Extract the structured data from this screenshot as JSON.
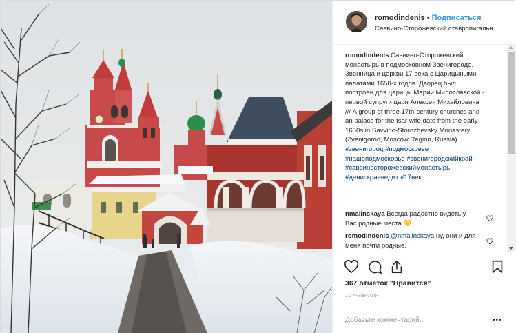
{
  "post": {
    "username": "romodindenis",
    "follow_label": "Подписаться",
    "dot": "•",
    "location": "Саввино-Сторожевский ставропигальн...",
    "caption": {
      "username": "romodindenis",
      "text": "Саввино-Сторожевский монастырь в подмосковном Звенигороде. Звонница и церкви 17 века с Царицыными палатами 1650-х годов. Дворец был построен для царицы Марии Милославской - первой супруги царя Алексея Михайловича /// A group of three 17th-century churches and an palace for the tsar wife date from the early 1650s in Savvino-Storozhevsky Monastery (Zvenigorod, Moscow Region, Russia)",
      "hashtags": [
        "#звенигород",
        "#подмосковье",
        "#нашеподмосковье",
        "#звенигородскийкрай",
        "#саввиносторожевскиймонастырь",
        "#денискраеведит",
        "#17век"
      ]
    },
    "comments": [
      {
        "username": "nmalinskaya",
        "text": "Всегда радостно видеть у Вас родные места.",
        "emoji": "💛"
      },
      {
        "username": "romodindenis",
        "mention": "@nmalinskaya",
        "text": "ну, они и для меня почти родные."
      }
    ],
    "likes": "367 отметок \"Нравится\"",
    "date": "10 ФЕВРАЛЯ",
    "add_comment_placeholder": "Добавьте комментарий...",
    "more_label": "•••"
  },
  "icons": {
    "like": "heart-icon",
    "comment": "comment-icon",
    "share": "share-icon",
    "save": "bookmark-icon"
  },
  "colors": {
    "link": "#003569",
    "follow": "#3897f0",
    "border": "#dbdbdb"
  }
}
